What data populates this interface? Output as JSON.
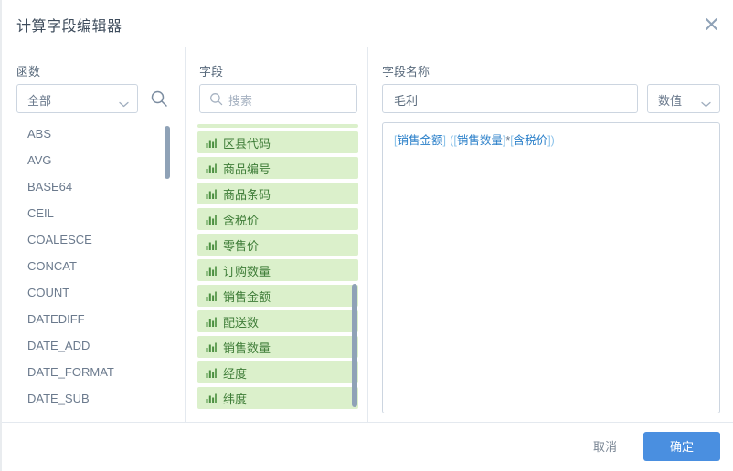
{
  "dialog": {
    "title": "计算字段编辑器",
    "close_icon": "close-icon"
  },
  "functions": {
    "label": "函数",
    "category_select": {
      "value": "全部",
      "chevron_icon": "chevron-down-icon"
    },
    "search_icon": "search-icon",
    "items": [
      "ABS",
      "AVG",
      "BASE64",
      "CEIL",
      "COALESCE",
      "CONCAT",
      "COUNT",
      "DATEDIFF",
      "DATE_ADD",
      "DATE_FORMAT",
      "DATE_SUB"
    ]
  },
  "fields": {
    "label": "字段",
    "search": {
      "value": "",
      "placeholder": "搜索",
      "icon": "search-icon"
    },
    "item_icon": "bar-chart-icon",
    "items": [
      "区县代码",
      "商品编号",
      "商品条码",
      "含税价",
      "零售价",
      "订购数量",
      "销售金额",
      "配送数",
      "销售数量",
      "经度",
      "纬度"
    ]
  },
  "field_name": {
    "label": "字段名称",
    "value": "毛利",
    "placeholder": "",
    "type_select": {
      "value": "数值",
      "chevron_icon": "chevron-down-icon"
    }
  },
  "expression": {
    "tokens": [
      {
        "t": "[",
        "k": "brk"
      },
      {
        "t": "销售金额",
        "k": "field"
      },
      {
        "t": "]",
        "k": "brk"
      },
      {
        "t": "-",
        "k": "op"
      },
      {
        "t": "(",
        "k": "brk"
      },
      {
        "t": "[",
        "k": "brk"
      },
      {
        "t": "销售数量",
        "k": "field"
      },
      {
        "t": "]",
        "k": "brk"
      },
      {
        "t": "*",
        "k": "op"
      },
      {
        "t": "[",
        "k": "brk"
      },
      {
        "t": "含税价",
        "k": "field"
      },
      {
        "t": "]",
        "k": "brk"
      },
      {
        "t": ")",
        "k": "brk"
      }
    ],
    "plain": "[销售金额]-([销售数量]*[含税价])"
  },
  "footer": {
    "cancel_label": "取消",
    "confirm_label": "确定"
  },
  "colors": {
    "primary": "#4a8fe0",
    "field_bg": "#dbf0cb",
    "field_text": "#3f7d38",
    "border": "#ccd5e0",
    "text": "#5a6b7d",
    "token_field": "#2a7fc9",
    "token_bracket": "#8dc3ea"
  }
}
